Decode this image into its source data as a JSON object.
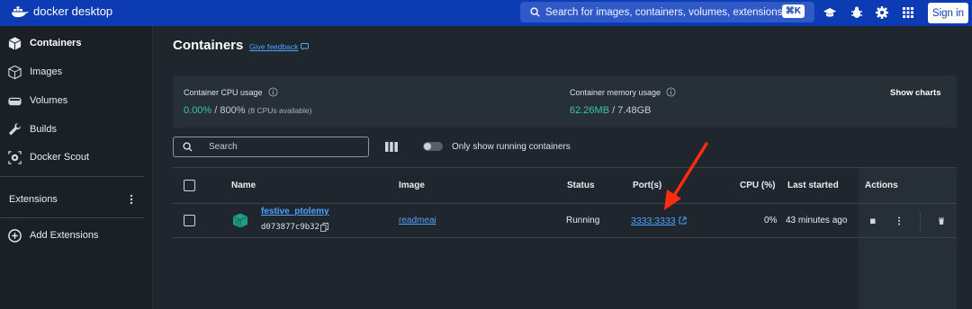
{
  "app": {
    "brand": "docker desktop",
    "search_placeholder": "Search for images, containers, volumes, extensions a...",
    "search_shortcut": "⌘K",
    "signin_label": "Sign in"
  },
  "sidebar": {
    "items": [
      {
        "label": "Containers",
        "icon": "container-icon",
        "active": true
      },
      {
        "label": "Images",
        "icon": "image-icon",
        "active": false
      },
      {
        "label": "Volumes",
        "icon": "volume-icon",
        "active": false
      },
      {
        "label": "Builds",
        "icon": "wrench-icon",
        "active": false
      },
      {
        "label": "Docker Scout",
        "icon": "scout-icon",
        "active": false
      }
    ],
    "extensions_label": "Extensions",
    "add_extensions_label": "Add Extensions"
  },
  "main": {
    "title": "Containers",
    "feedback_label": "Give feedback",
    "stats": {
      "cpu_label": "Container CPU usage",
      "cpu_value": "0.00%",
      "cpu_total": " / 800%",
      "cpu_note": "(8 CPUs available)",
      "memory_label": "Container memory usage",
      "memory_value": "62.26MB",
      "memory_total": " / 7.48GB",
      "show_charts_label": "Show charts"
    },
    "search_placeholder": "Search",
    "running_only_label": "Only show running containers",
    "table": {
      "headers": {
        "name": "Name",
        "image": "Image",
        "status": "Status",
        "ports": "Port(s)",
        "cpu": "CPU (%)",
        "last_started": "Last started",
        "actions": "Actions"
      },
      "rows": [
        {
          "name": "festive_ptolemy",
          "id": "d073877c9b32",
          "image": "readmeai",
          "status": "Running",
          "port": "3333:3333",
          "cpu": "0%",
          "last_started": "43 minutes ago"
        }
      ]
    }
  },
  "colors": {
    "topbar": "#0d3bb3",
    "accent_link": "#4da3ff",
    "green": "#3cc6a6",
    "annotation_arrow": "#ff2d10"
  }
}
